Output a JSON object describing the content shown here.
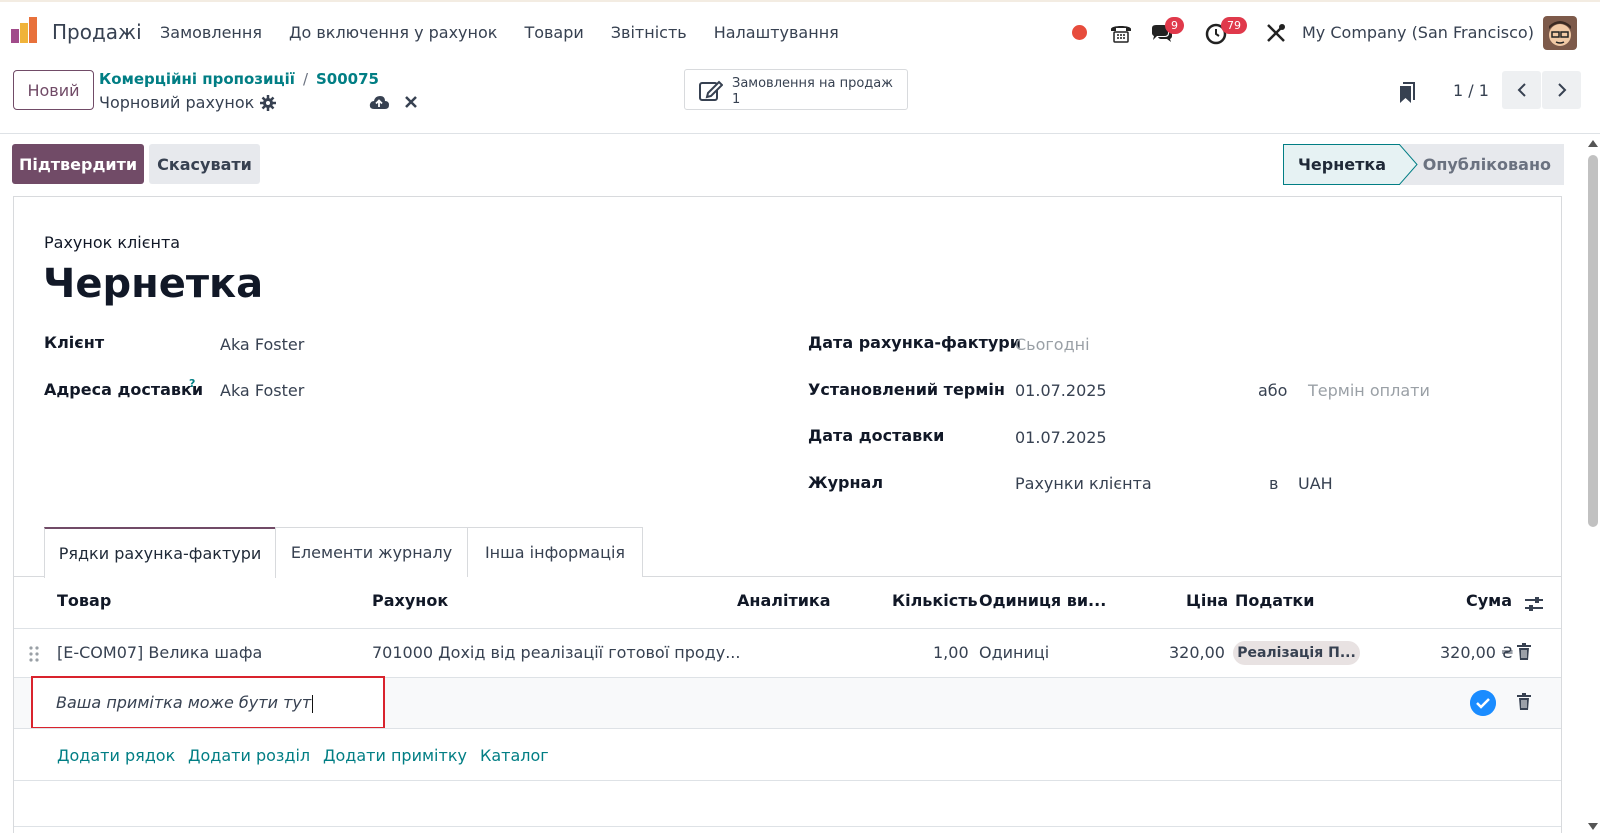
{
  "nav": {
    "app_name": "Продажі",
    "menu": [
      "Замовлення",
      "До включення у рахунок",
      "Товари",
      "Звітність",
      "Налаштування"
    ],
    "messages_badge": "9",
    "activities_badge": "79",
    "company": "My Company (San Francisco)"
  },
  "control": {
    "new_label": "Новий",
    "breadcrumb_parent": "Комерційні пропозиції",
    "breadcrumb_sep": "/",
    "breadcrumb_order": "S00075",
    "record_name": "Чорновий рахунок",
    "smart_button_label": "Замовлення на продаж",
    "smart_button_count": "1",
    "pager": "1 / 1"
  },
  "status": {
    "confirm_label": "Підтвердити",
    "cancel_label": "Скасувати",
    "stage_draft": "Чернетка",
    "stage_posted": "Опубліковано"
  },
  "form": {
    "doc_type": "Рахунок клієнта",
    "title": "Чернетка",
    "customer_label": "Клієнт",
    "customer_value": "Aka Foster",
    "delivery_address_label": "Адреса доставки",
    "delivery_address_help": "?",
    "delivery_address_value": "Aka Foster",
    "invoice_date_label": "Дата рахунка-фактури",
    "invoice_date_placeholder": "Сьогодні",
    "due_date_label": "Установлений термін",
    "due_date_value": "01.07.2025",
    "or_label": "або",
    "payment_terms_placeholder": "Термін оплати",
    "delivery_date_label": "Дата доставки",
    "delivery_date_value": "01.07.2025",
    "journal_label": "Журнал",
    "journal_value": "Рахунки клієнта",
    "in_label": "в",
    "currency_value": "UAH"
  },
  "tabs": [
    "Рядки рахунка-фактури",
    "Елементи журналу",
    "Інша інформація"
  ],
  "table": {
    "headers": {
      "product": "Товар",
      "account": "Рахунок",
      "analytic": "Аналітика",
      "quantity": "Кількість",
      "uom": "Одиниця ви...",
      "price": "Ціна",
      "taxes": "Податки",
      "amount": "Сума"
    },
    "rows": [
      {
        "product": "[E-COM07] Велика шафа",
        "account": "701000 Дохід від реалізації готової проду...",
        "quantity": "1,00",
        "uom": "Одиниці",
        "price": "320,00",
        "tax": "Реалізація П...",
        "amount": "320,00 ₴"
      }
    ],
    "note_text": "Ваша примітка може бути тут",
    "links": [
      "Додати рядок",
      "Додати розділ",
      "Додати примітку",
      "Каталог"
    ]
  },
  "colors": {
    "brand": "#714b67",
    "link": "#017e84",
    "badge": "#e0394b",
    "highlight": "#d9232d"
  }
}
